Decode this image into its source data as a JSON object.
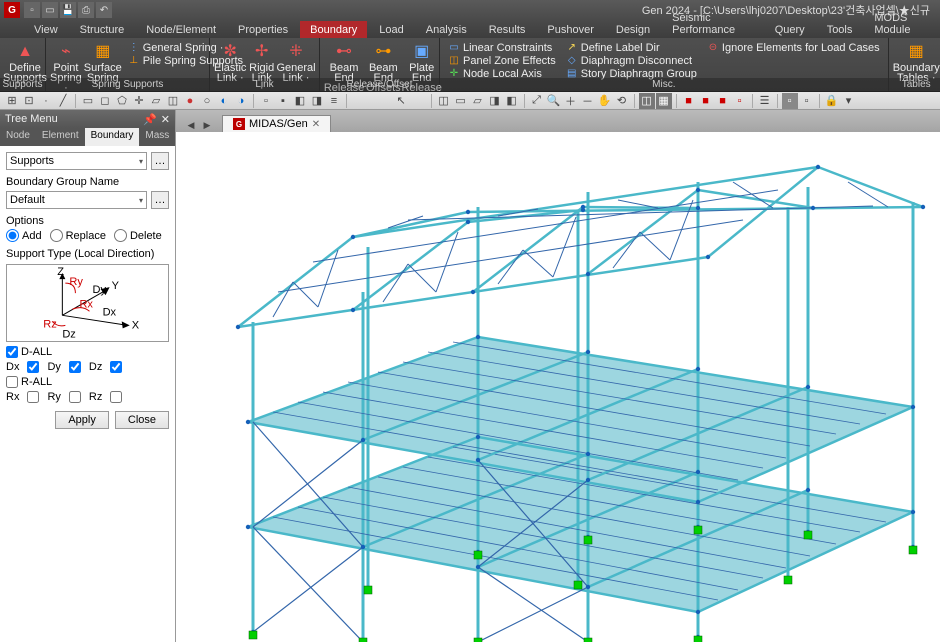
{
  "title": "Gen 2024 - [C:\\Users\\lhj0207\\Desktop\\23'건축사업셀\\★신규",
  "tabs": [
    "View",
    "Structure",
    "Node/Element",
    "Properties",
    "Boundary",
    "Load",
    "Analysis",
    "Results",
    "Pushover",
    "Design",
    "Seismic Performance",
    "Query",
    "Tools",
    "MODS Module"
  ],
  "activeTab": "Boundary",
  "ribbon": {
    "supports": {
      "label": "Supports",
      "define": "Define Supports"
    },
    "springSupports": {
      "label": "Spring Supports",
      "point": "Point Spring ·",
      "surface": "Surface Spring",
      "general": "General Spring ·",
      "pile": "Pile Spring Supports"
    },
    "link": {
      "label": "Link",
      "elastic": "Elastic Link ·",
      "rigid": "Rigid Link ·",
      "general": "General Link ·"
    },
    "releaseOffset": {
      "label": "Release/Offset",
      "beamEndRelease": "Beam End Release",
      "beamEndOffsets": "Beam End Offsets",
      "plateEndRelease": "Plate End Release"
    },
    "misc": {
      "label": "Misc.",
      "linear": "Linear Constraints",
      "panel": "Panel Zone Effects",
      "nodeLocal": "Node Local Axis",
      "defineLabel": "Define Label Dir",
      "diaphragmDisc": "Diaphragm Disconnect",
      "storyDiaphragm": "Story Diaphragm Group",
      "ignoreElements": "Ignore Elements for Load Cases"
    },
    "tables": {
      "label": "Tables",
      "boundaryTables": "Boundary Tables ·"
    }
  },
  "treeMenu": {
    "title": "Tree Menu",
    "tabs": [
      "Node",
      "Element",
      "Boundary",
      "Mass",
      "Load"
    ],
    "activeTab": "Boundary",
    "supportsDropdown": "Supports",
    "boundaryGroupLabel": "Boundary Group Name",
    "boundaryGroupValue": "Default",
    "optionsLabel": "Options",
    "options": [
      "Add",
      "Replace",
      "Delete"
    ],
    "selectedOption": "Add",
    "supportTypeLabel": "Support Type (Local Direction)",
    "dAll": "D-ALL",
    "dx": "Dx",
    "dy": "Dy",
    "dz": "Dz",
    "rAll": "R-ALL",
    "rx": "Rx",
    "ry": "Ry",
    "rz": "Rz",
    "apply": "Apply",
    "close": "Close"
  },
  "docTab": "MIDAS/Gen"
}
